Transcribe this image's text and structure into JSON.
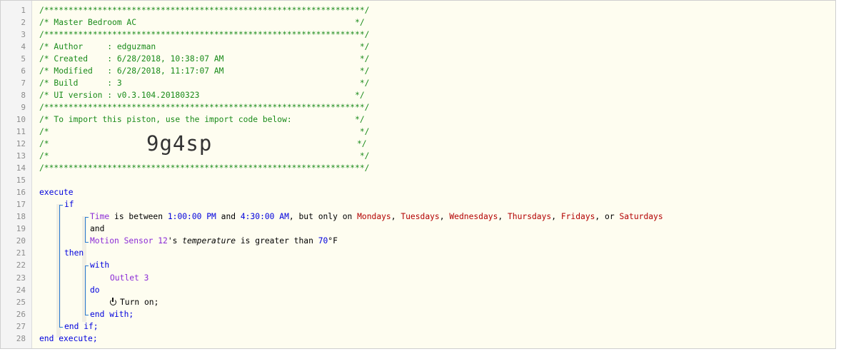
{
  "comment_block": {
    "border": "/******************************************************************/",
    "title_line": "/* Master Bedroom AC                                             */",
    "author_line": "/* Author     : edguzman                                          */",
    "created_line": "/* Created    : 6/28/2018, 10:38:07 AM                            */",
    "modified_line": "/* Modified   : 6/28/2018, 11:17:07 AM                            */",
    "build_line": "/* Build      : 3                                                 */",
    "ui_version_line": "/* UI version : v0.3.104.20180323                                */",
    "import_line": "/* To import this piston, use the import code below:             */",
    "blank_line": "/*                                                                */",
    "code_line_left": "/*",
    "code_line_right": "*/",
    "import_code": "9g4sp"
  },
  "line_numbers": [
    "1",
    "2",
    "3",
    "4",
    "5",
    "6",
    "7",
    "8",
    "9",
    "10",
    "11",
    "12",
    "13",
    "14",
    "15",
    "16",
    "17",
    "18",
    "19",
    "20",
    "21",
    "22",
    "23",
    "24",
    "25",
    "26",
    "27",
    "28"
  ],
  "script": {
    "execute": "execute",
    "if": "if",
    "cond1": {
      "subject": "Time",
      "text1": " is between ",
      "start": "1:00:00 PM",
      "text2": " and ",
      "end": "4:30:00 AM",
      "text3": ", but only on ",
      "days": [
        "Mondays",
        "Tuesdays",
        "Wednesdays",
        "Thursdays",
        "Fridays",
        "Saturdays"
      ],
      "sep": ", ",
      "or_sep": ", or "
    },
    "and": "and",
    "cond2": {
      "device": "Motion Sensor 12",
      "poss": "'s ",
      "attribute": "temperature",
      "text": " is greater than ",
      "value": "70",
      "unit": "°F"
    },
    "then": "then",
    "with": "with",
    "target": "Outlet 3",
    "do": "do",
    "action": "Turn on;",
    "end_with": "end with;",
    "end_if": "end if;",
    "end_execute": "end execute;"
  },
  "colors": {
    "comment": "#1a8b1a",
    "keyword": "#0000dd",
    "device": "#8b2bd6",
    "day": "#b30000",
    "guide": "#2a7bd1"
  }
}
